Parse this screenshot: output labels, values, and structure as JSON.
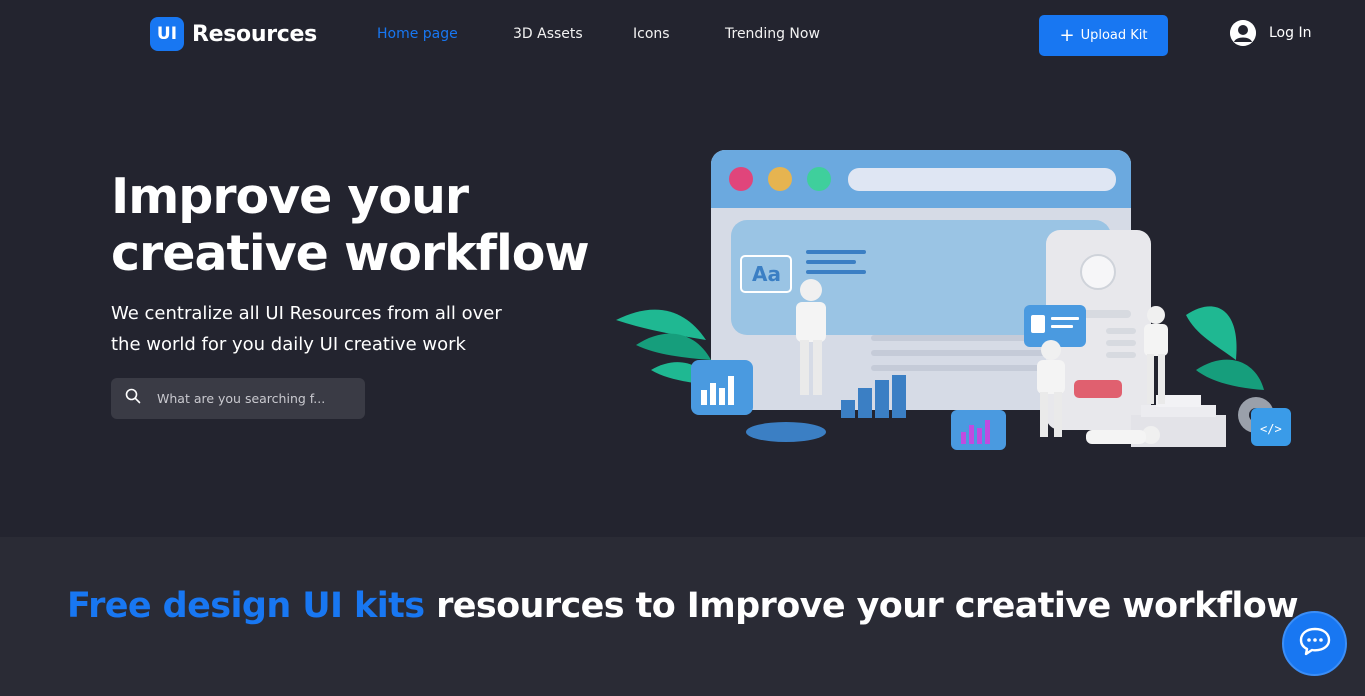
{
  "brand": {
    "badge": "UI",
    "name": "Resources",
    "accent": "#1877f2",
    "background": "#23242f"
  },
  "nav": {
    "items": [
      {
        "label": "Home page",
        "active": true
      },
      {
        "label": "3D Assets",
        "active": false
      },
      {
        "label": "Icons",
        "active": false
      },
      {
        "label": "Trending Now",
        "active": false
      }
    ]
  },
  "header": {
    "upload_label": "Upload Kit",
    "upload_icon": "plus-icon",
    "login_label": "Log In",
    "login_icon": "user-avatar-icon"
  },
  "hero": {
    "title": "Improve your\ncreative workflow",
    "subtitle": "We centralize all UI Resources from all over the world for you daily UI creative work",
    "search_placeholder": "What are you searching f...",
    "search_icon": "search-icon",
    "illustration_text": "Aa"
  },
  "section2": {
    "title_highlight": "Free design UI kits",
    "title_rest": " resources to Improve your creative workflow"
  },
  "chat": {
    "icon": "chat-bubble-icon"
  }
}
